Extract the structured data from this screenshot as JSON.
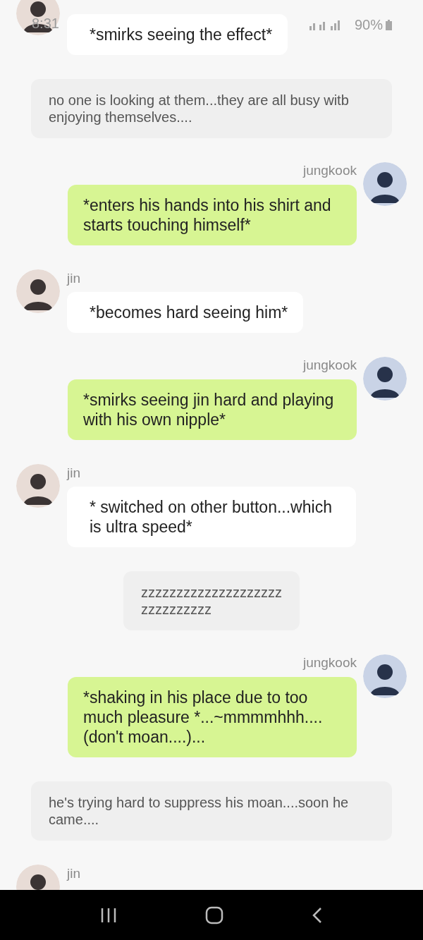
{
  "status_bar": {
    "time": "8:31",
    "battery": "90%"
  },
  "messages": [
    {
      "kind": "left",
      "text": "*smirks seeing the effect*"
    },
    {
      "kind": "narration",
      "text": "no one is looking at them...they are all busy witb enjoying themselves...."
    },
    {
      "kind": "right",
      "name": "jungkook",
      "text": "*enters his hands into his shirt and starts touching himself*"
    },
    {
      "kind": "left",
      "name": "jin",
      "text": "*becomes hard seeing him*"
    },
    {
      "kind": "right",
      "name": "jungkook",
      "text": "*smirks seeing jin hard and playing with his own nipple*"
    },
    {
      "kind": "left",
      "name": "jin",
      "text": "* switched on other button...which is ultra speed*"
    },
    {
      "kind": "center",
      "text": "zzzzzzzzzzzzzzzzzzzzzzzzzzzzzz"
    },
    {
      "kind": "right",
      "name": "jungkook",
      "text": "*shaking in his place due to too much pleasure *...~mmmmhhh.... (don't moan....)..."
    },
    {
      "kind": "narration",
      "text": "he's trying hard to suppress his moan....soon he came...."
    },
    {
      "kind": "left",
      "name": "jin"
    }
  ]
}
